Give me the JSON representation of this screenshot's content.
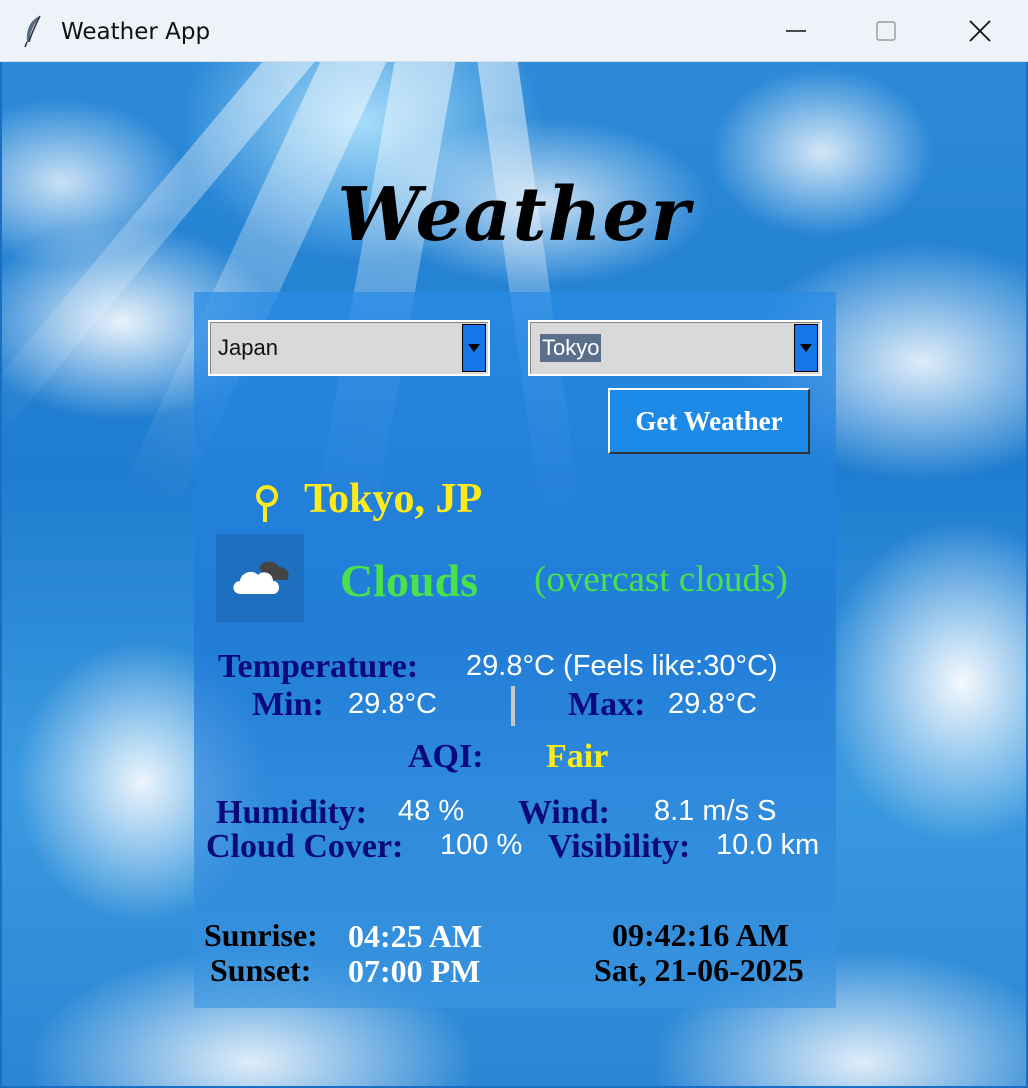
{
  "window": {
    "title": "Weather App",
    "icon": "feather-icon"
  },
  "app": {
    "heading": "Weather"
  },
  "controls": {
    "country_value": "Japan",
    "city_value": "Tokyo",
    "get_weather_label": "Get Weather"
  },
  "weather": {
    "location": "Tokyo, JP",
    "condition": "Clouds",
    "description": "(overcast clouds)",
    "condition_icon": "cloud-icon",
    "temperature_label": "Temperature:",
    "temperature_value": "29.8°C (Feels like:30°C)",
    "min_label": "Min:",
    "min_value": "29.8°C",
    "max_label": "Max:",
    "max_value": "29.8°C",
    "aqi_label": "AQI:",
    "aqi_value": "Fair",
    "humidity_label": "Humidity:",
    "humidity_value": "48 %",
    "wind_label": "Wind:",
    "wind_value": "8.1 m/s S",
    "cloud_cover_label": "Cloud Cover:",
    "cloud_cover_value": "100 %",
    "visibility_label": "Visibility:",
    "visibility_value": "10.0 km",
    "sunrise_label": "Sunrise:",
    "sunrise_value": "04:25 AM",
    "sunset_label": "Sunset:",
    "sunset_value": "07:00 PM",
    "current_time": "09:42:16 AM",
    "current_date": "Sat, 21-06-2025"
  },
  "colors": {
    "location": "#ffeb1a",
    "condition": "#4ae24a",
    "label": "#0a0a78",
    "button": "#1c8ae6"
  }
}
